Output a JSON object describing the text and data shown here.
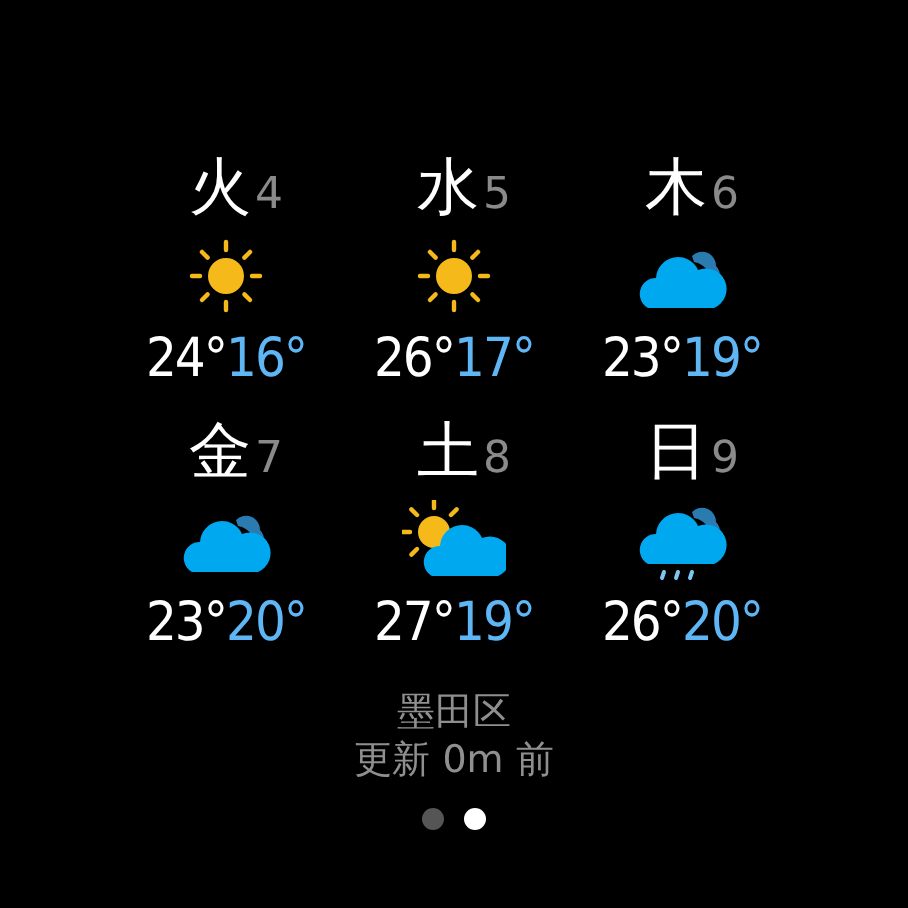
{
  "days": [
    {
      "day": "火",
      "date": "4",
      "kind": "sunny",
      "high": "24°",
      "low": "16°"
    },
    {
      "day": "水",
      "date": "5",
      "kind": "sunny",
      "high": "26°",
      "low": "17°"
    },
    {
      "day": "木",
      "date": "6",
      "kind": "cloudy",
      "high": "23°",
      "low": "19°"
    },
    {
      "day": "金",
      "date": "7",
      "kind": "cloudy",
      "high": "23°",
      "low": "20°"
    },
    {
      "day": "土",
      "date": "8",
      "kind": "partly_sunny",
      "high": "27°",
      "low": "19°"
    },
    {
      "day": "日",
      "date": "9",
      "kind": "rain",
      "high": "26°",
      "low": "20°"
    }
  ],
  "location": "墨田区",
  "updated": "更新 0m 前",
  "pages": [
    {
      "selected": false
    },
    {
      "selected": true
    }
  ]
}
